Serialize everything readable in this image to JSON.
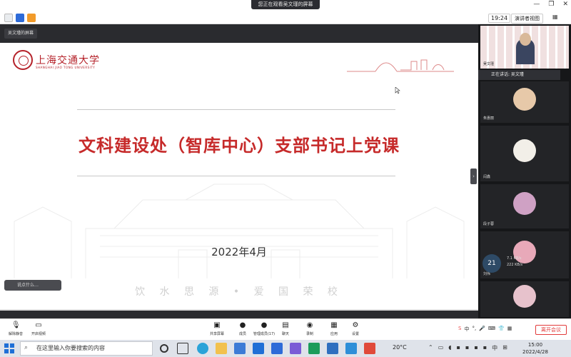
{
  "banner": {
    "text": "您正在观看吴文瑾的屏幕"
  },
  "toolbar": {
    "clock": "19:24",
    "view_label": "演讲者视图"
  },
  "main": {
    "speaker_tag": "吴文瑾的屏幕",
    "chat_placeholder": "说点什么…"
  },
  "slide": {
    "logo_text": "上海交通大学",
    "logo_sub": "SHANGHAI JIAO TONG UNIVERSITY",
    "title": "文科建设处（智库中心）支部书记上党课",
    "date": "2022年4月",
    "motto": "饮 水 思 源 • 爱 国 荣 校"
  },
  "right_panel": {
    "speaking": "正在讲话: 吴文瑾",
    "tiles": [
      {
        "name": "吴文瑾"
      },
      {
        "name": "朱惠丽"
      },
      {
        "name": "闫鑫"
      },
      {
        "name": "段子蓉"
      },
      {
        "name": "刘伟"
      },
      {
        "name": ""
      }
    ],
    "net": {
      "badge": "21",
      "up": "7.1 KB/s",
      "down": "222 KB/s"
    }
  },
  "meeting_bar": {
    "items": [
      {
        "label": "解除静音"
      },
      {
        "label": "开启视频"
      },
      {
        "label": "共享屏幕"
      },
      {
        "label": "成员"
      },
      {
        "label": "管理成员(17)"
      },
      {
        "label": "聊天"
      },
      {
        "label": "录制"
      },
      {
        "label": "应用"
      },
      {
        "label": "设置"
      }
    ],
    "end_label": "离开会议",
    "ime": [
      "中",
      "°,",
      "🎤",
      "⌨",
      "👕",
      "▦"
    ]
  },
  "taskbar": {
    "search_placeholder": "在这里输入你要搜索的内容",
    "weather": "20°C",
    "time": "15:00",
    "date": "2022/4/28",
    "ime_lang": "中"
  },
  "colors": {
    "accent_red": "#c62a2a",
    "meeting_blue": "#2e6bd8",
    "end_red": "#e23b3b"
  }
}
